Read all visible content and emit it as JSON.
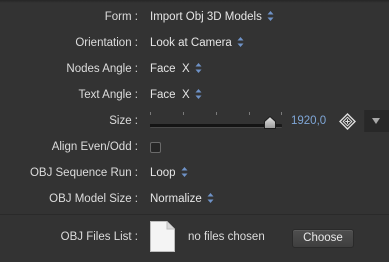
{
  "form": {
    "label": "Form :",
    "value": "Import Obj 3D Models"
  },
  "orientation": {
    "label": "Orientation :",
    "value": "Look at Camera"
  },
  "nodes_angle": {
    "label": "Nodes Angle :",
    "value": "Face  X"
  },
  "text_angle": {
    "label": "Text Angle :",
    "value": "Face  X"
  },
  "size": {
    "label": "Size :",
    "value": "1920,0",
    "slider_fraction": 0.91
  },
  "align_even_odd": {
    "label": "Align Even/Odd :",
    "checked": false
  },
  "obj_sequence_run": {
    "label": "OBJ Sequence Run :",
    "value": "Loop"
  },
  "obj_model_size": {
    "label": "OBJ Model Size :",
    "value": "Normalize"
  },
  "obj_files_list": {
    "label": "OBJ Files List :",
    "status": "no files chosen",
    "button_label": "Choose"
  },
  "icons": {
    "popup": "up-down-arrows-icon",
    "keyframe": "diamond-keyframe-icon",
    "menu": "triangle-down-icon",
    "file": "blank-document-icon"
  },
  "colors": {
    "background": "#333333",
    "accent_value": "#7fa6d6",
    "popup_arrows": "#6f93c8"
  }
}
